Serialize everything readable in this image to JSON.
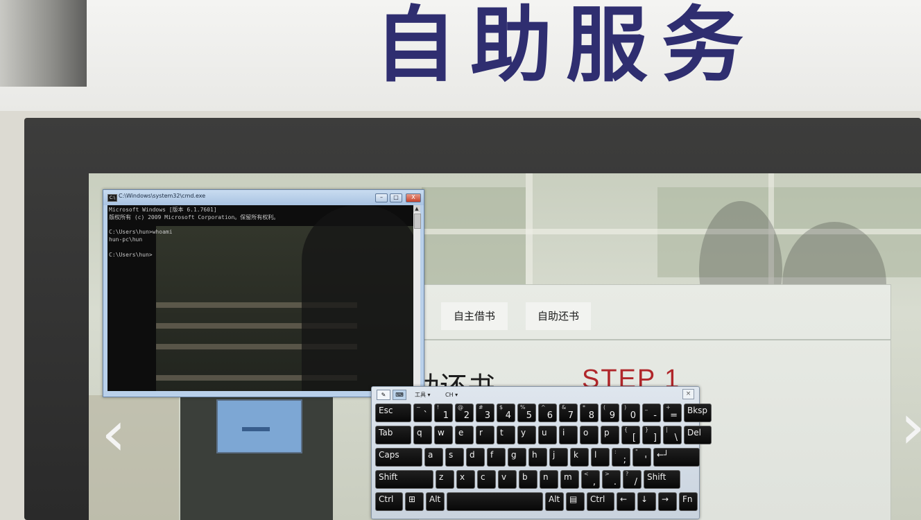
{
  "sign": {
    "title": "自助服务"
  },
  "cmd": {
    "title": "C:\\Windows\\system32\\cmd.exe",
    "icon": "cmd-app-icon",
    "icon_text": "C:\\",
    "buttons": {
      "minimize": "–",
      "maximize": "□",
      "close": "X"
    },
    "lines": [
      "Microsoft Windows [版本 6.1.7601]",
      "版权所有 (c) 2009 Microsoft Corporation。保留所有权利。",
      "",
      "C:\\Users\\hun>whoami",
      "hun-pc\\hun",
      "",
      "C:\\Users\\hun>"
    ]
  },
  "kiosk": {
    "tabs": [
      "自主借书",
      "自助还书"
    ],
    "heading": "助还书",
    "step": "STEP 1",
    "nav": {
      "prev": "‹",
      "next": "›"
    }
  },
  "keyboard": {
    "toolbar": {
      "pen_icon": "✎",
      "keyboard_icon": "⌨",
      "tools": "工具 ▾",
      "lang": "CH ▾",
      "close": "×"
    },
    "rows": [
      [
        {
          "label": "Esc",
          "w": 52
        },
        {
          "label": "`",
          "sub": "~",
          "w": 27
        },
        {
          "label": "1",
          "sub": "!",
          "w": 27
        },
        {
          "label": "2",
          "sub": "@",
          "w": 27
        },
        {
          "label": "3",
          "sub": "#",
          "w": 27
        },
        {
          "label": "4",
          "sub": "$",
          "w": 27
        },
        {
          "label": "5",
          "sub": "%",
          "w": 27
        },
        {
          "label": "6",
          "sub": "^",
          "w": 27
        },
        {
          "label": "7",
          "sub": "&",
          "w": 27
        },
        {
          "label": "8",
          "sub": "*",
          "w": 27
        },
        {
          "label": "9",
          "sub": "(",
          "w": 27
        },
        {
          "label": "0",
          "sub": ")",
          "w": 27
        },
        {
          "label": "-",
          "sub": "_",
          "w": 27
        },
        {
          "label": "=",
          "sub": "+",
          "w": 27
        },
        {
          "label": "Bksp",
          "w": 40
        }
      ],
      [
        {
          "label": "Tab",
          "w": 52
        },
        {
          "label": "q",
          "w": 27
        },
        {
          "label": "w",
          "w": 27
        },
        {
          "label": "e",
          "w": 27
        },
        {
          "label": "r",
          "w": 27
        },
        {
          "label": "t",
          "w": 27
        },
        {
          "label": "y",
          "w": 27
        },
        {
          "label": "u",
          "w": 27
        },
        {
          "label": "i",
          "w": 27
        },
        {
          "label": "o",
          "w": 27
        },
        {
          "label": "p",
          "w": 27
        },
        {
          "label": "[",
          "sub": "{",
          "w": 27
        },
        {
          "label": "]",
          "sub": "}",
          "w": 27
        },
        {
          "label": "\\",
          "sub": "|",
          "w": 27
        },
        {
          "label": "Del",
          "w": 40
        }
      ],
      [
        {
          "label": "Caps",
          "w": 68
        },
        {
          "label": "a",
          "w": 27
        },
        {
          "label": "s",
          "w": 27
        },
        {
          "label": "d",
          "w": 27
        },
        {
          "label": "f",
          "w": 27
        },
        {
          "label": "g",
          "w": 27
        },
        {
          "label": "h",
          "w": 27
        },
        {
          "label": "j",
          "w": 27
        },
        {
          "label": "k",
          "w": 27
        },
        {
          "label": "l",
          "w": 27
        },
        {
          "label": ";",
          "sub": ":",
          "w": 27
        },
        {
          "label": "'",
          "sub": "\"",
          "w": 27
        },
        {
          "label": "←┘",
          "w": 67
        }
      ],
      [
        {
          "label": "Shift",
          "w": 84
        },
        {
          "label": "z",
          "w": 27
        },
        {
          "label": "x",
          "w": 27
        },
        {
          "label": "c",
          "w": 27
        },
        {
          "label": "v",
          "w": 27
        },
        {
          "label": "b",
          "w": 27
        },
        {
          "label": "n",
          "w": 27
        },
        {
          "label": "m",
          "w": 27
        },
        {
          "label": ",",
          "sub": "<",
          "w": 27
        },
        {
          "label": ".",
          "sub": ">",
          "w": 27
        },
        {
          "label": "/",
          "sub": "?",
          "w": 27
        },
        {
          "label": "Shift",
          "w": 53
        }
      ],
      [
        {
          "label": "Ctrl",
          "w": 40
        },
        {
          "label": "⊞",
          "w": 27
        },
        {
          "label": "Alt",
          "w": 27
        },
        {
          "label": "",
          "w": 139
        },
        {
          "label": "Alt",
          "w": 27
        },
        {
          "label": "▤",
          "w": 27
        },
        {
          "label": "Ctrl",
          "w": 40
        },
        {
          "label": "←",
          "w": 27
        },
        {
          "label": "↓",
          "w": 27
        },
        {
          "label": "→",
          "w": 27
        },
        {
          "label": "Fn",
          "w": 27
        }
      ]
    ]
  }
}
